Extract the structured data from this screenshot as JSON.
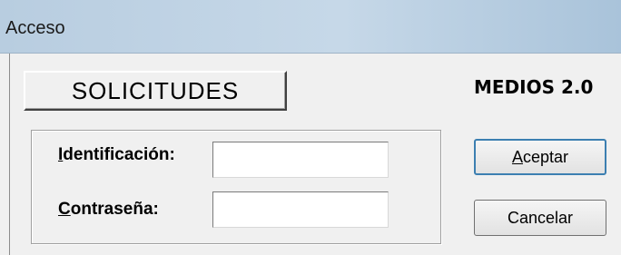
{
  "window": {
    "title": "Acceso"
  },
  "header": {
    "solicitudes_label": "SOLICITUDES",
    "app_name": "MEDIOS 2.0"
  },
  "form": {
    "identificacion": {
      "label_underlined": "I",
      "label_rest": "dentificación:",
      "value": ""
    },
    "contrasena": {
      "label_underlined": "C",
      "label_rest": "ontraseña:",
      "value": ""
    }
  },
  "buttons": {
    "aceptar": {
      "underlined": "A",
      "rest": "ceptar"
    },
    "cancelar": {
      "label": "Cancelar"
    }
  }
}
